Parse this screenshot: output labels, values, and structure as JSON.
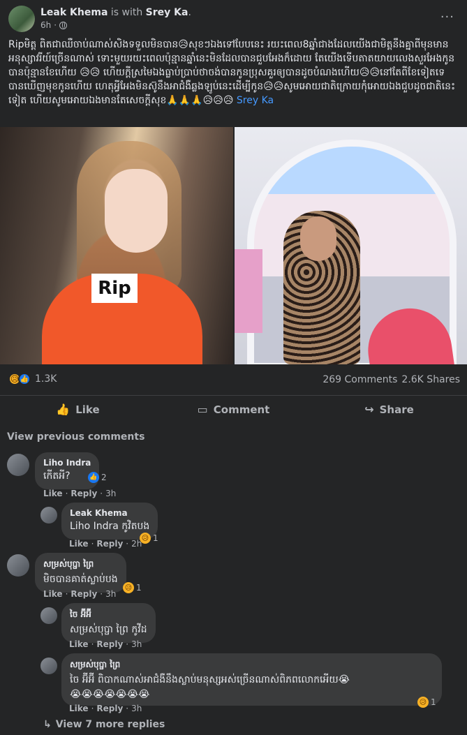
{
  "post": {
    "author": "Leak Khema",
    "with_text": "is with",
    "with_name": "Srey Ka",
    "time": "6h",
    "more": "···",
    "text": "Ripមិត្ត ពិតជាឈឺចាប់ណាស់សិងទទួលមិនបាន😥សុខៗឯងទៅបែបនេះ រយះពេល8ឆ្នាំជាងដែលយើងជាមិត្តនឹងគ្នាពីមុនមានអនុស្សាវរីយ៍ច្រើនណាស់ ទោះមួយរយះពេលប៉ុន្មានឆ្នាំនេះមិនដែលបានជួបអែងក៏ដោយ តែយើងទើបតាតយាយលេងសួរអែងកូនបានប៉ុន្មានខែហើយ 😥😥 ហើយក្ដីស្រមៃឯងធ្លាប់ប្រាប់ថាចង់បានកូនប្រុសគួរឲ្យបានដូចបំណងហើយ😥😥នៅតែពីខែទៀតទេបានឃើញមុខកូនហើយ ហេតុអ្វីអែងមិនស៊ូនឹងអាជំងឺឆ្លងឡូប់នេះដើម្បីកូន😥😥សូមអោយជាតិក្រោយកុំអោយឯងជួបដូចជាតិនេះទៀត ហើយសូមអោយឯងមានតែសេចក្ដីសុខ🙏🙏🙏😥😥😥",
    "tag": "Srey Ka",
    "rip_label": "Rip"
  },
  "stats": {
    "reaction_count": "1.3K",
    "comments": "269 Comments",
    "shares": "2.6K Shares"
  },
  "actions": {
    "like": "Like",
    "comment": "Comment",
    "share": "Share"
  },
  "comments": {
    "view_previous": "View previous comments",
    "like_label": "Like",
    "reply_label": "Reply",
    "items": [
      {
        "name": "Liho Indra",
        "text": "កើតអី?",
        "time": "3h",
        "count": "2"
      },
      {
        "name": "Leak Khema",
        "text": "Liho Indra កូវិតបង",
        "time": "2h",
        "count": "1"
      },
      {
        "name": "សម្រស់បុប្ផា ព្រៃ",
        "text": "មិចបានគាត់ស្លាប់បង",
        "time": "3h",
        "count": "1"
      },
      {
        "name": "ចៃ អ៊ីអ៊ី",
        "text": "សម្រស់បុប្ផា ព្រៃ កូវីដ",
        "time": "3h"
      },
      {
        "name": "សម្រស់បុប្ផា ព្រៃ",
        "text": "ចៃ អ៊ីអ៊ី ពិបាកណាស់អាជំងឺនឹងស្លាប់មនុស្សអស់ច្រើនណាស់ពិភពលោកអើយ😭",
        "text2": "😭😭😭😭😭😭😭",
        "time": "3h",
        "count": "1"
      }
    ],
    "view_more": "View 7 more replies"
  },
  "icons": {
    "sad": "😥",
    "like": "👍",
    "reply_arrow": "↳"
  }
}
